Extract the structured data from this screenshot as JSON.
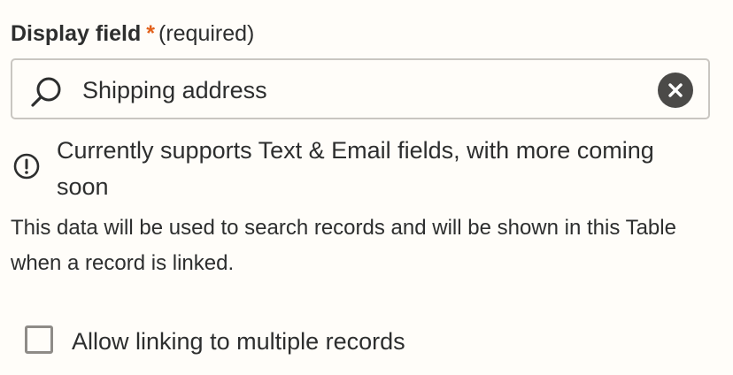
{
  "field": {
    "label": "Display field",
    "required_marker": "*",
    "required_text": "(required)"
  },
  "search": {
    "value": "Shipping address",
    "search_icon": "search-icon",
    "clear_icon": "close-circle-icon"
  },
  "notice": {
    "icon": "alert-circle-icon",
    "text": "Currently supports Text & Email fields, with more coming soon"
  },
  "help": {
    "text": "This data will be used to search records and will be shown in this Table when a record is linked."
  },
  "multiple": {
    "label": "Allow linking to multiple records",
    "checked": false
  },
  "colors": {
    "required_star": "#e2601a",
    "text": "#2d2e2e",
    "border": "#c9c6c1",
    "background": "#fffdf9"
  }
}
